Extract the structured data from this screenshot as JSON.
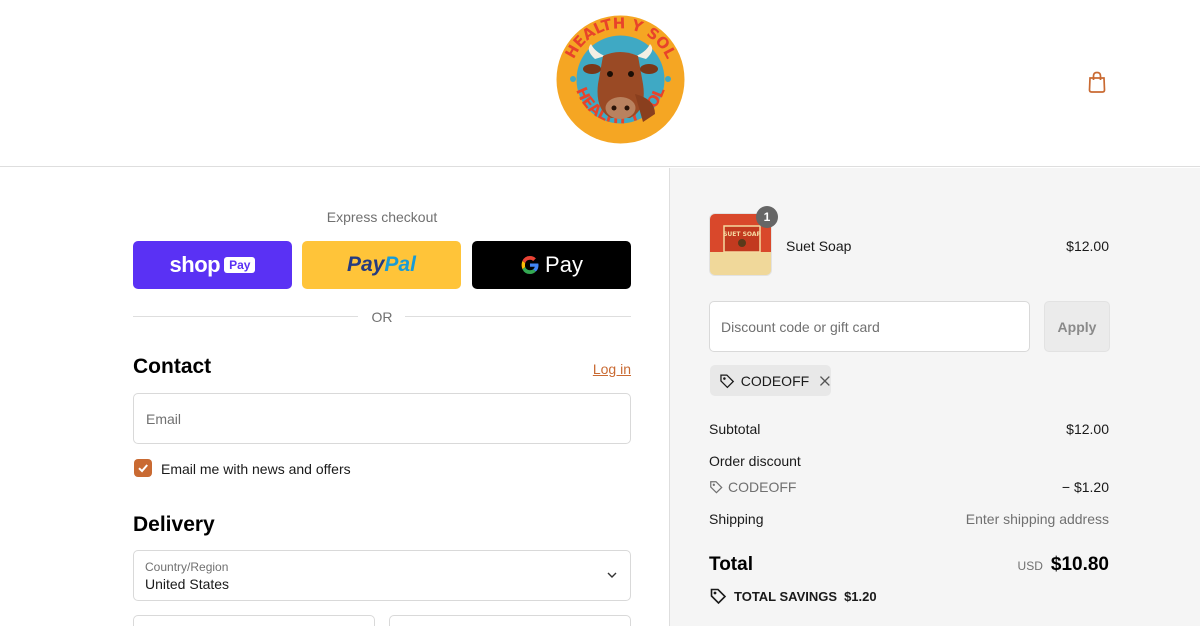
{
  "header": {
    "logo_text": "HEALTH Y SOL",
    "cart_icon": "shopping-bag-icon"
  },
  "express": {
    "label": "Express checkout",
    "shop_pay": {
      "word": "shop",
      "tag": "Pay"
    },
    "paypal": {
      "part1": "Pay",
      "part2": "Pal"
    },
    "google_pay": {
      "g": "G",
      "pay": "Pay"
    },
    "or_label": "OR"
  },
  "contact": {
    "title": "Contact",
    "login_label": "Log in",
    "email_placeholder": "Email",
    "newsletter_label": "Email me with news and offers",
    "newsletter_checked": true
  },
  "delivery": {
    "title": "Delivery",
    "country_label": "Country/Region",
    "country_value": "United States"
  },
  "summary": {
    "product": {
      "name": "Suet Soap",
      "price": "$12.00",
      "quantity": "1",
      "thumb_text": "SUET SOAP"
    },
    "discount_placeholder": "Discount code or gift card",
    "apply_label": "Apply",
    "applied_code": "CODEOFF",
    "subtotal_label": "Subtotal",
    "subtotal_value": "$12.00",
    "order_discount_label": "Order discount",
    "discount_code": "CODEOFF",
    "discount_value": "− $1.20",
    "shipping_label": "Shipping",
    "shipping_value": "Enter shipping address",
    "total_label": "Total",
    "currency": "USD",
    "total_value": "$10.80",
    "savings_label": "TOTAL SAVINGS",
    "savings_value": "$1.20"
  },
  "colors": {
    "accent": "#c96a32",
    "shop_pay": "#5a31f4",
    "paypal": "#ffc439",
    "google_pay": "#000000"
  }
}
